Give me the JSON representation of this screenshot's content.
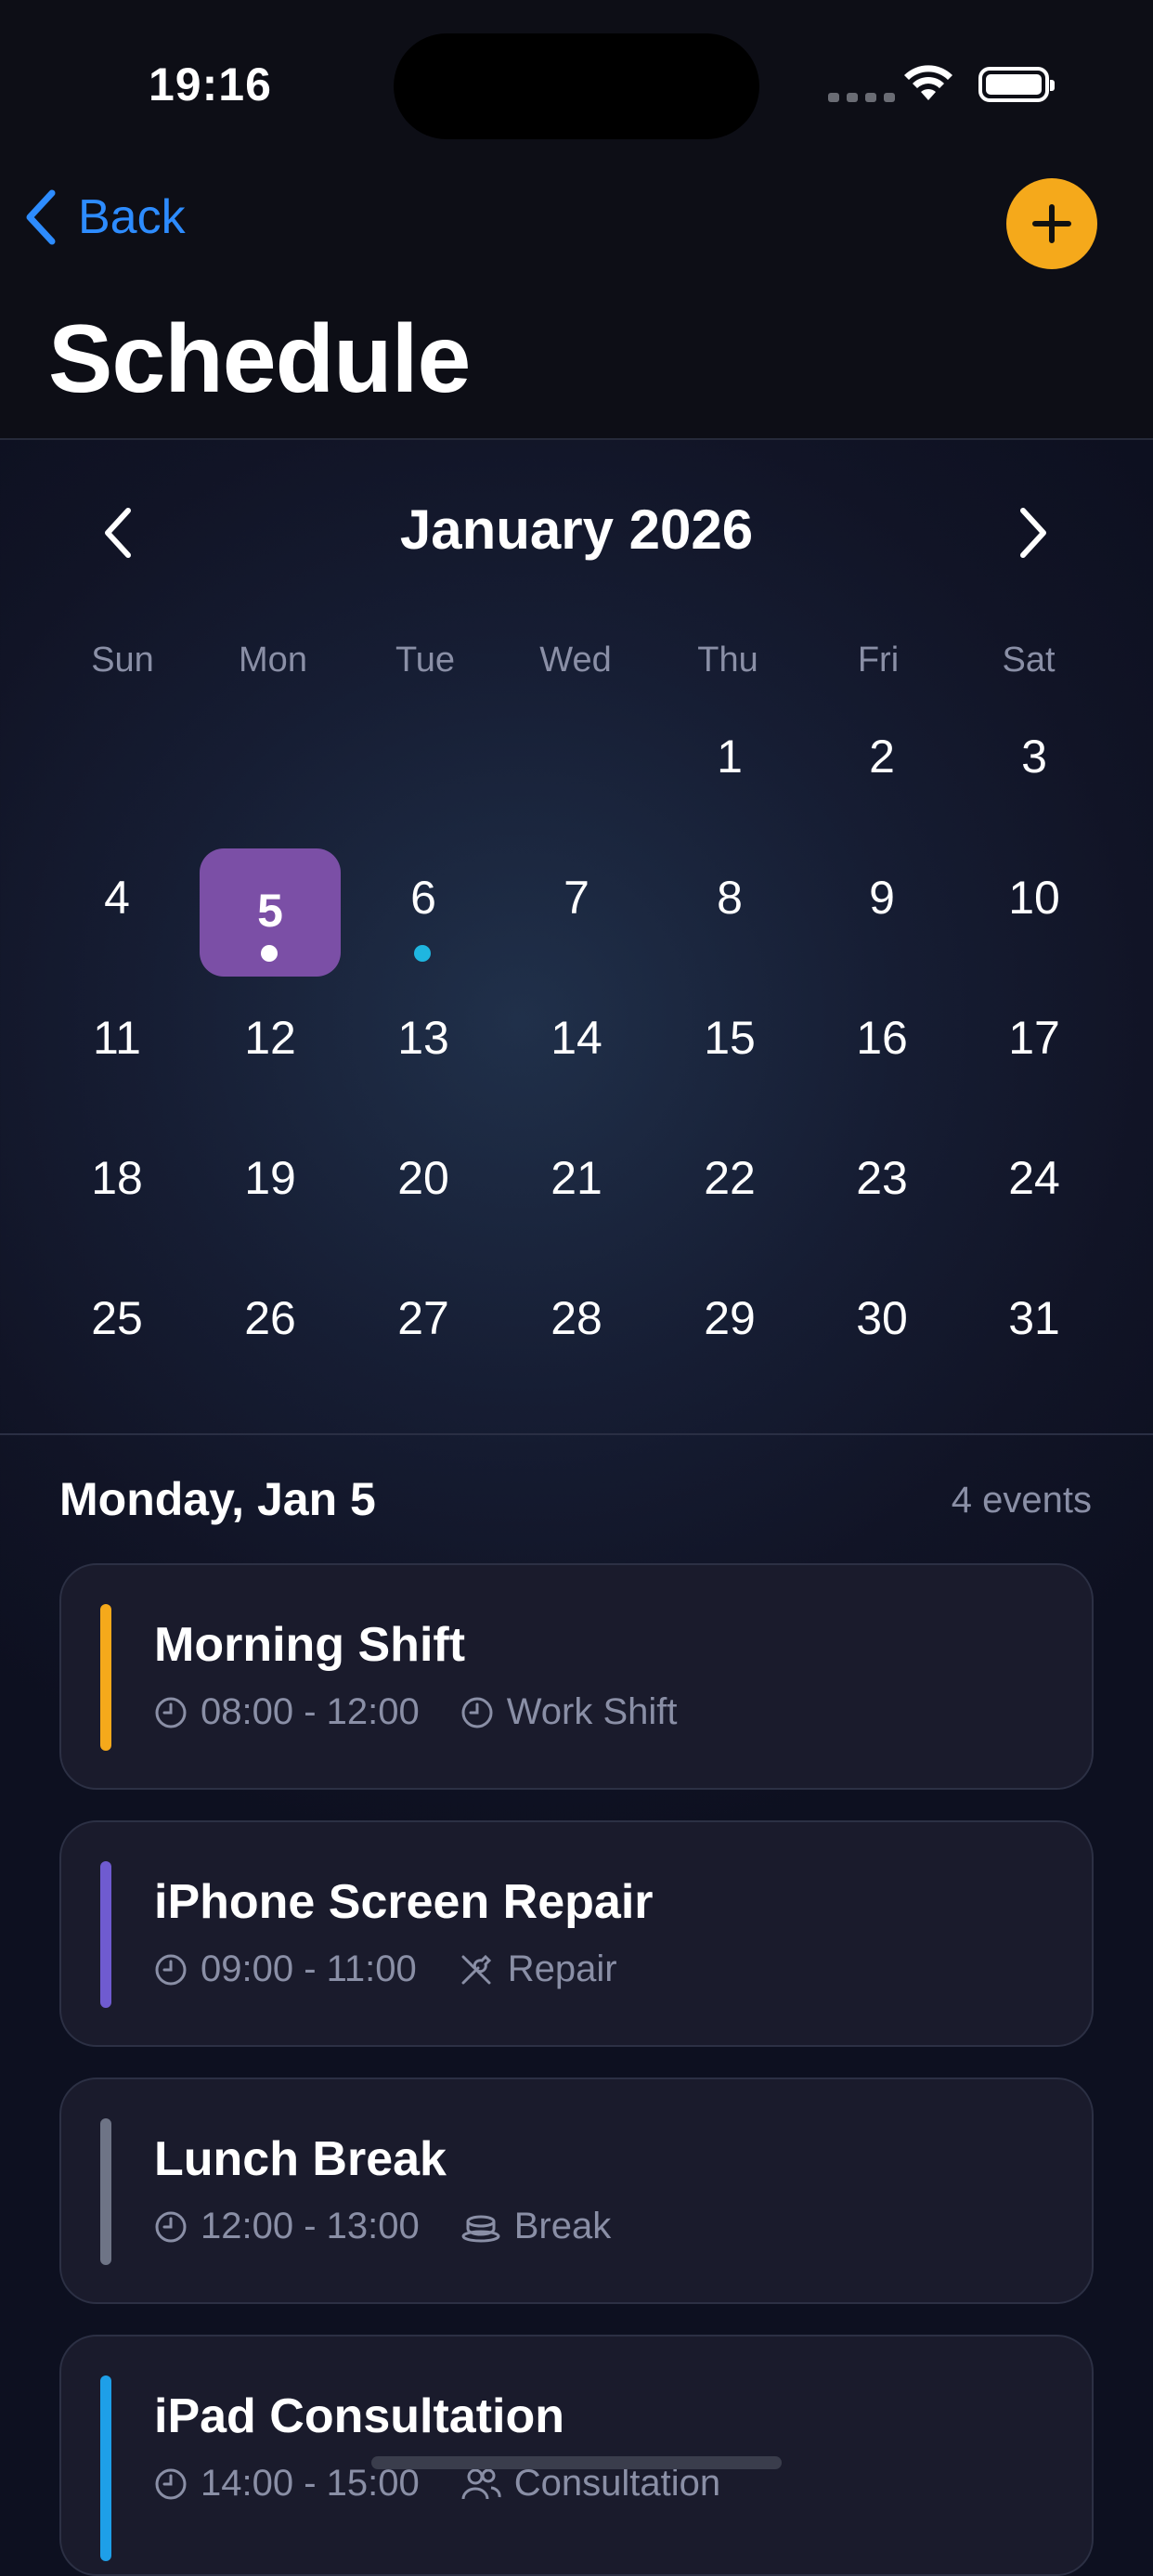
{
  "status_bar": {
    "time": "19:16"
  },
  "nav": {
    "back_label": "Back",
    "title": "Schedule"
  },
  "calendar": {
    "month_title": "January 2026",
    "weekdays": [
      "Sun",
      "Mon",
      "Tue",
      "Wed",
      "Thu",
      "Fri",
      "Sat"
    ],
    "days": [
      "1",
      "2",
      "3",
      "4",
      "5",
      "6",
      "7",
      "8",
      "9",
      "10",
      "11",
      "12",
      "13",
      "14",
      "15",
      "16",
      "17",
      "18",
      "19",
      "20",
      "21",
      "22",
      "23",
      "24",
      "25",
      "26",
      "27",
      "28",
      "29",
      "30",
      "31"
    ],
    "selected_day": "5",
    "accent_selected": "#7b4fa6",
    "dot_color_today": "#ffffff",
    "dot_color_event": "#1fb6e0"
  },
  "events_section": {
    "title": "Monday, Jan 5",
    "count": "4 events",
    "events": [
      {
        "title": "Morning Shift",
        "time": "08:00 - 12:00",
        "category": "Work Shift",
        "color": "#f5a91b",
        "icon": "clock-icon"
      },
      {
        "title": "iPhone Screen Repair",
        "time": "09:00 - 11:00",
        "category": "Repair",
        "color": "#6f5bd0",
        "icon": "tools-icon"
      },
      {
        "title": "Lunch Break",
        "time": "12:00 - 13:00",
        "category": "Break",
        "color": "#6e7486",
        "icon": "cup-icon"
      },
      {
        "title": "iPad Consultation",
        "time": "14:00 - 15:00",
        "category": "Consultation",
        "color": "#1e9fe8",
        "icon": "people-icon"
      }
    ]
  }
}
